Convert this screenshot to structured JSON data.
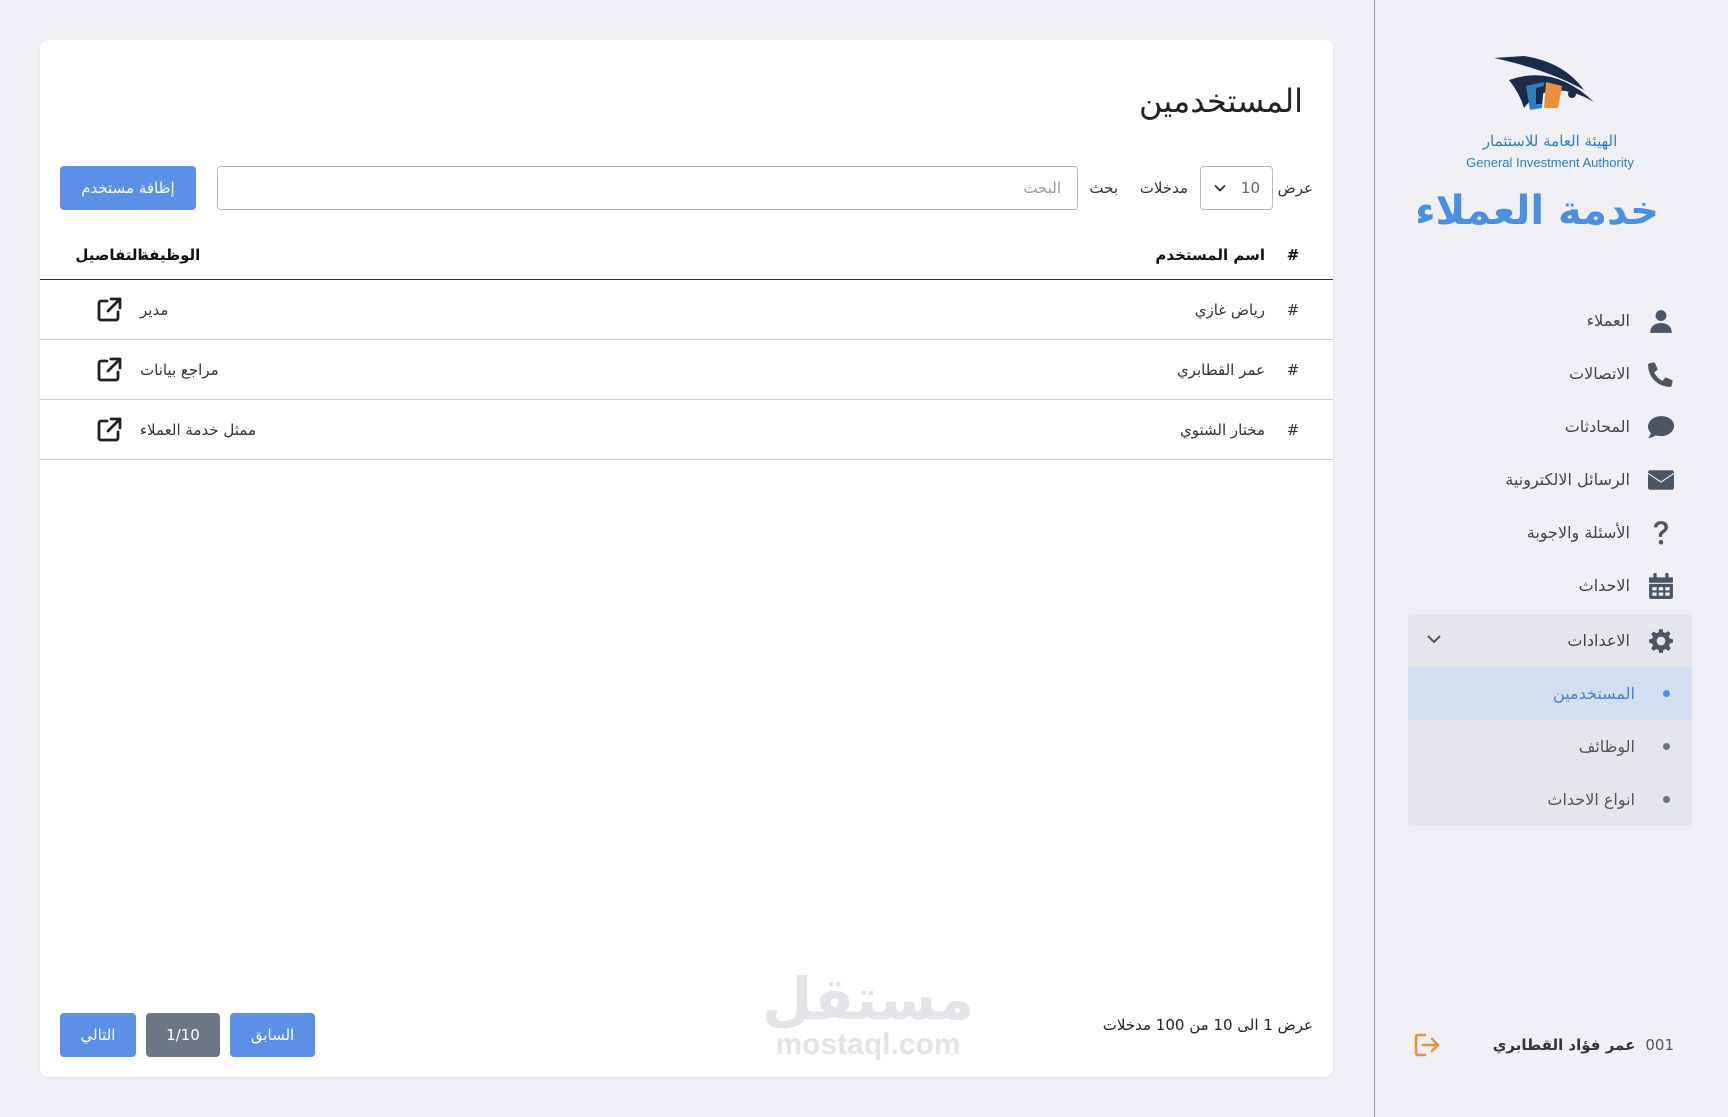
{
  "sidebar": {
    "logo_ar": "الهيئة العامة للاستثمار",
    "logo_en": "General Investment Authority",
    "brand": "خدمة العملاء",
    "nav": [
      {
        "label": "العملاء",
        "icon": "user-icon"
      },
      {
        "label": "الاتصالات",
        "icon": "phone-icon"
      },
      {
        "label": "المحادثات",
        "icon": "chat-bubble-icon"
      },
      {
        "label": "الرسائل الالكترونية",
        "icon": "envelope-icon"
      },
      {
        "label": "الأسئلة والاجوبة",
        "icon": "question-mark-icon"
      },
      {
        "label": "الاحداث",
        "icon": "calendar-icon"
      }
    ],
    "settings": {
      "label": "الاعدادات",
      "icon": "gear-icon",
      "expanded": true,
      "items": [
        {
          "label": "المستخدمين",
          "active": true
        },
        {
          "label": "الوظائف",
          "active": false
        },
        {
          "label": "انواع الاحداث",
          "active": false
        }
      ]
    },
    "user": {
      "code": "001",
      "name": "عمر فؤاد القطابري",
      "logout_icon": "logout-icon"
    }
  },
  "main": {
    "title": "المستخدمين",
    "toolbar": {
      "show_label": "عرض",
      "page_size": "10",
      "entries_label": "مدخلات",
      "search_label": "بحث",
      "search_placeholder": "البحث",
      "search_value": "",
      "add_button": "إظافة مستخدم"
    },
    "table": {
      "headers": {
        "hash": "#",
        "name": "اسم المستخدم",
        "job": "الوظيفة",
        "details": "التفاصيل"
      },
      "rows": [
        {
          "hash": "#",
          "name": "رياض غازي",
          "job": "مدير"
        },
        {
          "hash": "#",
          "name": "عمر القطابري",
          "job": "مراجع بيانات"
        },
        {
          "hash": "#",
          "name": "مختار الشتوي",
          "job": "ممثل خدمة العملاء"
        }
      ]
    },
    "footer": {
      "info": "عرض 1 الى 10 من 100 مدخلات",
      "prev": "السابق",
      "page": "1/10",
      "next": "التالي"
    }
  },
  "watermark": {
    "ar": "مستقل",
    "en": "mostaql.com"
  },
  "colors": {
    "accent": "#5b8fe8",
    "brand": "#4a90e2",
    "page_btn": "#6b7785",
    "active_sub_bg": "#d3def1",
    "logout": "#e8913a"
  }
}
